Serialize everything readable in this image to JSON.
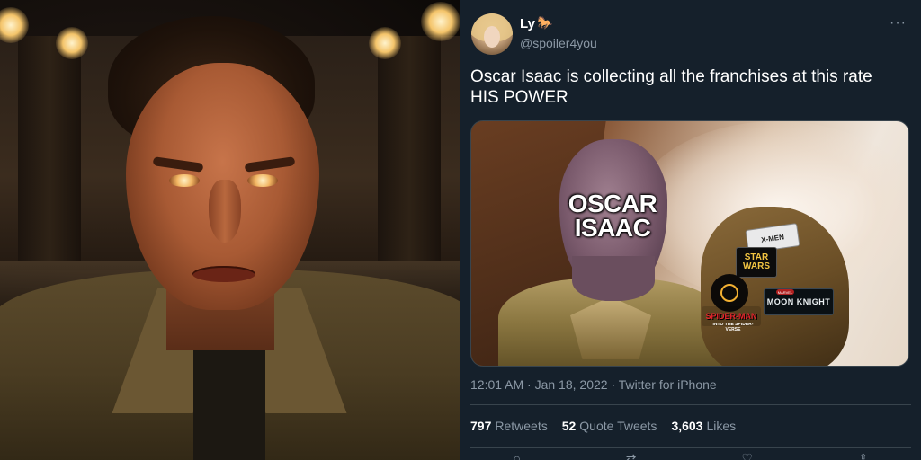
{
  "tweet": {
    "display_name": "Ly",
    "name_emoji": "🐎",
    "handle": "@spoiler4you",
    "more_icon": "more-icon",
    "text_line1": "Oscar Isaac is collecting all the franchises at this rate",
    "text_line2": "HIS POWER",
    "media": {
      "thanos_label_line1": "OSCAR",
      "thanos_label_line2": "ISAAC",
      "logos": {
        "xmen": "X-MEN",
        "star_wars_line1": "STAR",
        "star_wars_line2": "WARS",
        "spiderman": "SPIDER-MAN",
        "spiderman_sub": "INTO THE SPIDER-VERSE",
        "moon_knight": "MOON KNIGHT",
        "moon_knight_sub": "MARVEL"
      }
    },
    "timestamp": "12:01 AM · Jan 18, 2022 · Twitter for iPhone",
    "stats": {
      "retweets_count": "797",
      "retweets_label": "Retweets",
      "quote_count": "52",
      "quote_label": "Quote Tweets",
      "likes_count": "3,603",
      "likes_label": "Likes"
    }
  },
  "colors": {
    "background": "#15202b",
    "text_primary": "#ffffff",
    "text_secondary": "#8b98a5",
    "divider": "#38444d"
  }
}
